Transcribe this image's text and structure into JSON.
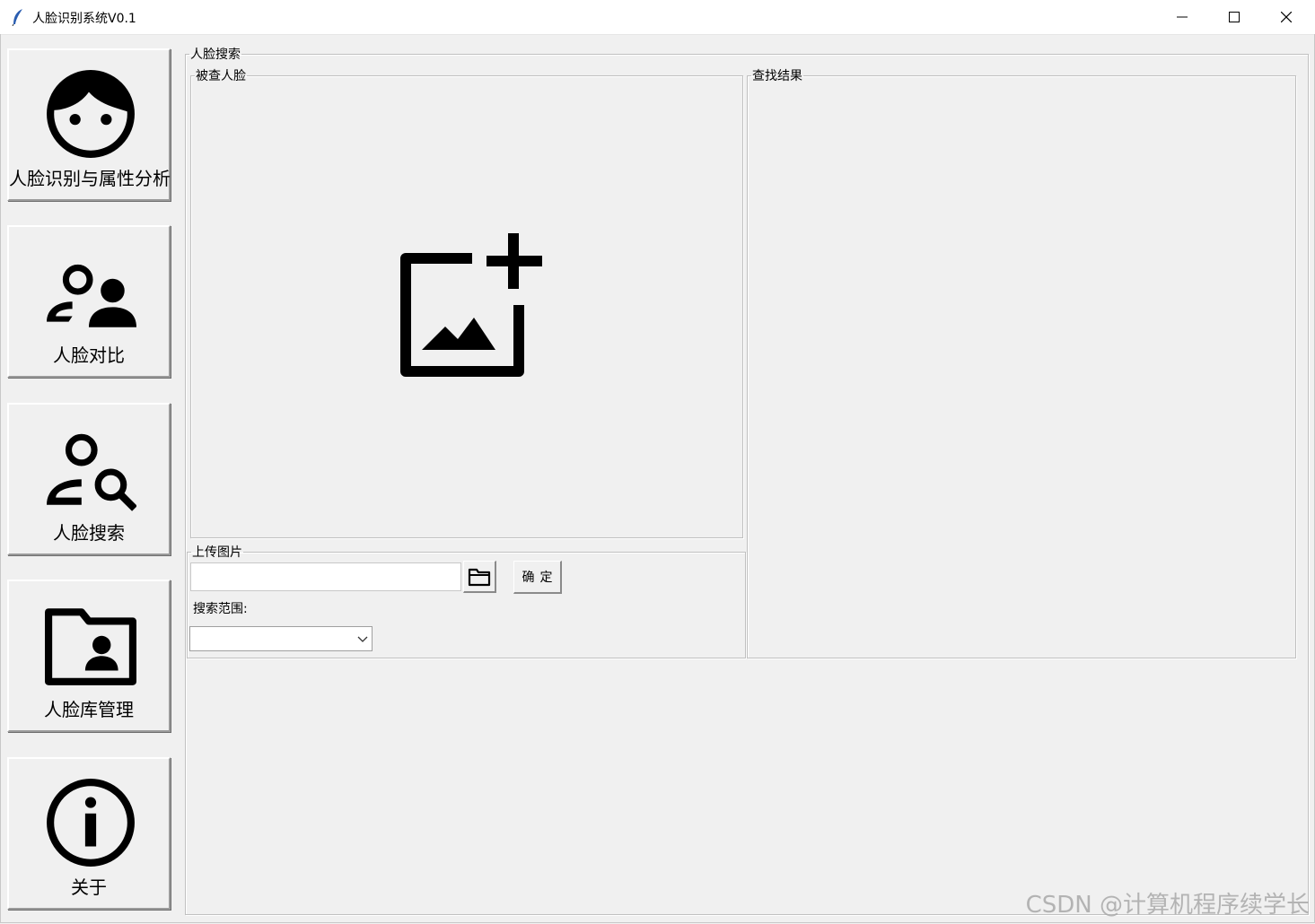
{
  "window": {
    "title": "人脸识别系统V0.1",
    "minimize_glyph": "—",
    "maximize_glyph": "☐",
    "close_glyph": "✕"
  },
  "sidebar": {
    "items": [
      {
        "label": "人脸识别与属性分析",
        "icon": "face-icon"
      },
      {
        "label": "人脸对比",
        "icon": "people-compare-icon"
      },
      {
        "label": "人脸搜索",
        "icon": "person-search-icon"
      },
      {
        "label": "人脸库管理",
        "icon": "folder-person-icon"
      },
      {
        "label": "关于",
        "icon": "info-icon"
      }
    ]
  },
  "main": {
    "group_title": "人脸搜索",
    "query_face": {
      "title": "被查人脸",
      "placeholder_icon": "add-photo-icon"
    },
    "results": {
      "title": "查找结果"
    },
    "upload": {
      "title": "上传图片",
      "path_value": "",
      "browse_icon": "folder-icon",
      "confirm_label": "确定",
      "range_label": "搜索范围:",
      "range_value": ""
    }
  },
  "watermark": "CSDN @计算机程序续学长"
}
